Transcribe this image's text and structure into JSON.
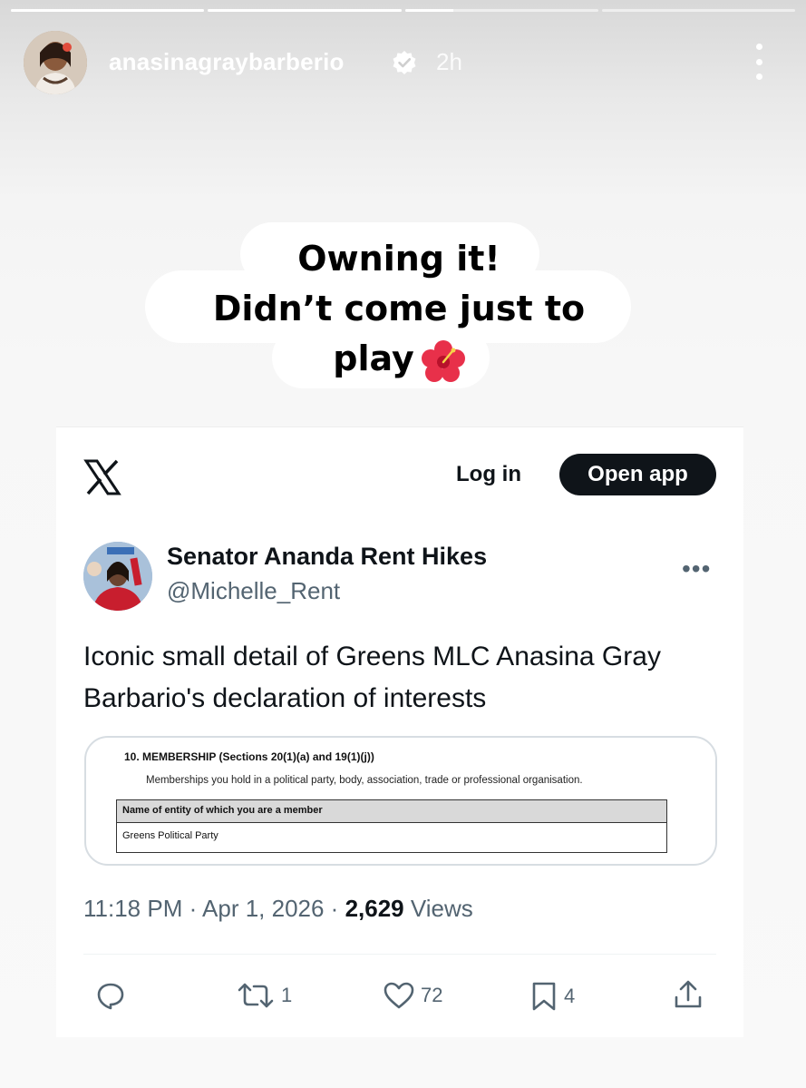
{
  "story": {
    "progress": [
      1.0,
      1.0,
      0.25,
      0.0
    ],
    "username": "anasinagraybarberio",
    "time": "2h",
    "caption_lines": [
      "Owning it!",
      "Didn’t come just to",
      "play"
    ]
  },
  "tweet": {
    "login_label": "Log in",
    "open_app_label": "Open app",
    "display_name": "Senator Ananda Rent Hikes",
    "handle": "@Michelle_Rent",
    "text": "Iconic small detail of Greens MLC Anasina Gray Barbario's declaration of interests",
    "media": {
      "heading": "10. MEMBERSHIP (Sections 20(1)(a) and 19(1)(j))",
      "subheading": "Memberships you hold in a political party, body, association, trade or professional organisation.",
      "table_header": "Name of entity of which you are a member",
      "table_value": "Greens Political Party"
    },
    "timestamp": "11:18 PM · Apr 1, 2026 · ",
    "views_count": "2,629",
    "views_label": " Views",
    "replies": "",
    "reposts": "1",
    "likes": "72",
    "bookmarks": "4"
  },
  "colors": {
    "text_primary": "#0f1419",
    "text_secondary": "#536471",
    "button_dark": "#0f1419"
  }
}
